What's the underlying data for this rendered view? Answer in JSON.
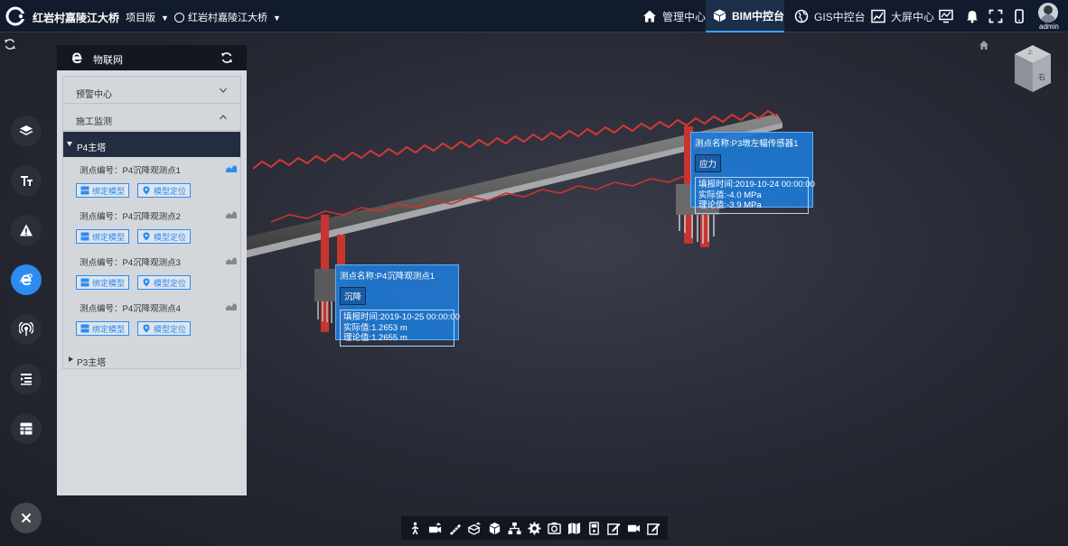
{
  "header": {
    "app_title": "红岩村嘉陵江大桥",
    "project_select": "项目版",
    "bridge_select": "红岩村嘉陵江大桥",
    "nav": [
      {
        "label": "管理中心",
        "icon": "home-icon",
        "active": false
      },
      {
        "label": "BIM中控台",
        "icon": "cube-icon",
        "active": true
      },
      {
        "label": "GIS中控台",
        "icon": "globe-icon",
        "active": false
      },
      {
        "label": "大屏中心",
        "icon": "chart-icon",
        "active": false
      }
    ],
    "user": "admin"
  },
  "iot_panel": {
    "title": "物联网",
    "sections": [
      {
        "label": "预警中心",
        "expanded": false
      },
      {
        "label": "施工监测",
        "expanded": true
      }
    ],
    "tree": {
      "p4": {
        "label": "P4主塔",
        "points": [
          {
            "label": "测点编号：P4沉降观测点1"
          },
          {
            "label": "测点编号：P4沉降观测点2"
          },
          {
            "label": "测点编号：P4沉降观测点3"
          },
          {
            "label": "测点编号：P4沉降观测点4"
          }
        ]
      },
      "p3": {
        "label": "P3主塔"
      }
    },
    "bind_button": "绑定模型",
    "locate_button": "模型定位"
  },
  "popups": {
    "a": {
      "name": "测点名称:P3墩左幅传感器1",
      "tag": "应力",
      "time": "填报时间:2019-10-24 00:00:00",
      "actual": "实际值:-4.0 MPa",
      "theory": "理论值:-3.9 MPa"
    },
    "b": {
      "name": "测点名称:P4沉降观测点1",
      "tag": "沉降",
      "time": "填报时间:2019-10-25 00:00:00",
      "actual": "实际值:1.2653 m",
      "theory": "理论值:1.2655 m"
    }
  },
  "nav_cube_face": "右",
  "colors": {
    "accent": "#2d8cf0",
    "topbar": "#121b2b",
    "popup": "#1e78d2",
    "bridge_red": "#c8342f"
  }
}
